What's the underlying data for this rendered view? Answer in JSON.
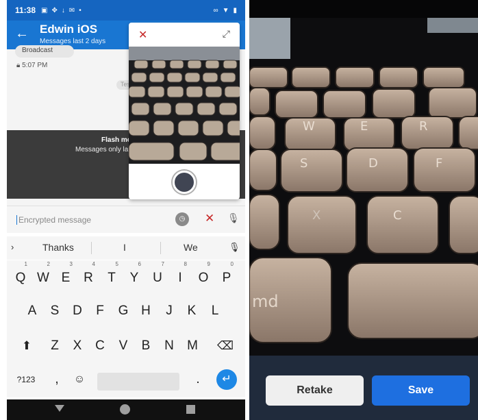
{
  "status_bar": {
    "time": "11:38"
  },
  "app_bar": {
    "title": "Edwin iOS",
    "subtitle": "Messages last 2 days"
  },
  "chat": {
    "top_bubble_text": "Broadcast",
    "message_time": "5:07 PM",
    "right_bubble_text": "Test",
    "flash_title": "Flash mo",
    "flash_subtitle": "Messages only la"
  },
  "input": {
    "placeholder": "Encrypted message"
  },
  "suggestions": [
    "Thanks",
    "I",
    "We"
  ],
  "keyboard": {
    "row1": [
      {
        "key": "Q",
        "hint": "1"
      },
      {
        "key": "W",
        "hint": "2"
      },
      {
        "key": "E",
        "hint": "3"
      },
      {
        "key": "R",
        "hint": "4"
      },
      {
        "key": "T",
        "hint": "5"
      },
      {
        "key": "Y",
        "hint": "6"
      },
      {
        "key": "U",
        "hint": "7"
      },
      {
        "key": "I",
        "hint": "8"
      },
      {
        "key": "O",
        "hint": "9"
      },
      {
        "key": "P",
        "hint": "0"
      }
    ],
    "row2": [
      "A",
      "S",
      "D",
      "F",
      "G",
      "H",
      "J",
      "K",
      "L"
    ],
    "row3": [
      "Z",
      "X",
      "C",
      "V",
      "B",
      "N",
      "M"
    ],
    "symbols_key": "?123",
    "comma_key": ",",
    "period_key": "."
  },
  "photo_preview": {
    "retake_label": "Retake",
    "save_label": "Save"
  },
  "colors": {
    "app_bar": "#1976d2",
    "status_bar": "#1565c0",
    "save_button": "#1e6fe0",
    "retake_button": "#efefef",
    "bottom_bar": "#202b3c",
    "close_icon": "#c62828"
  }
}
